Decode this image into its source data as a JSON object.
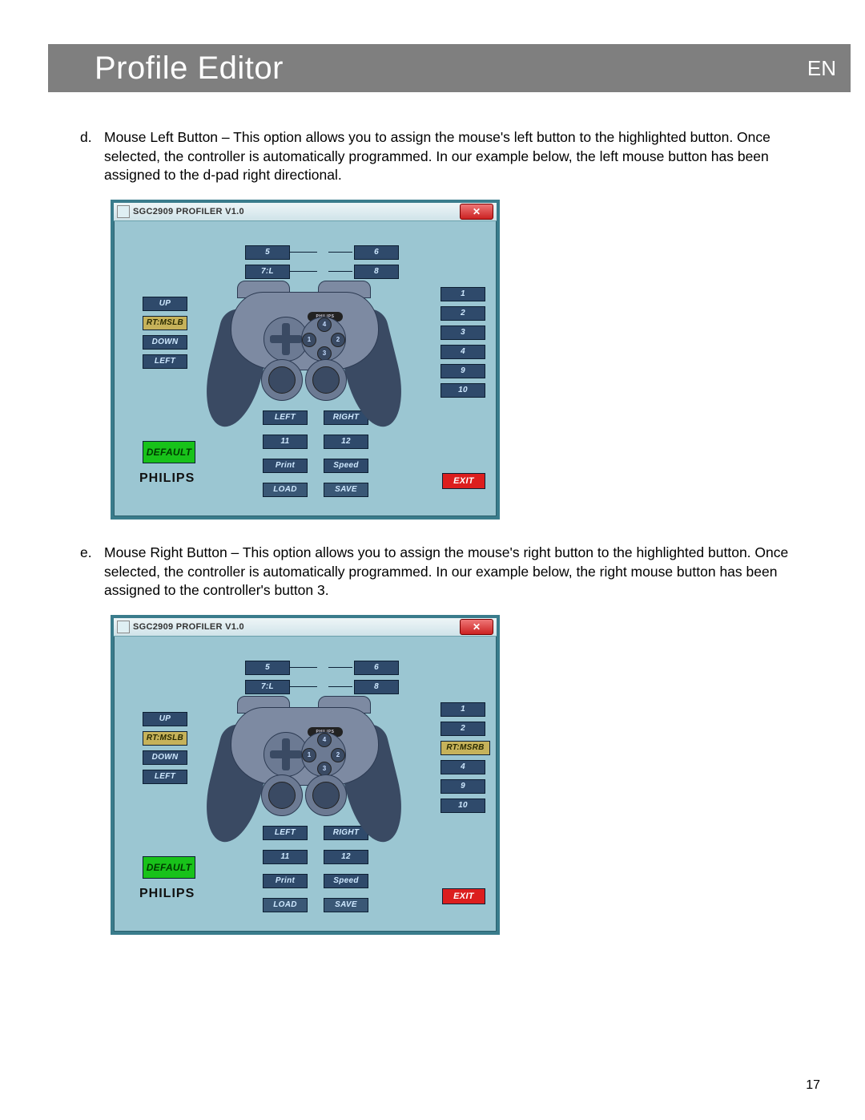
{
  "header": {
    "title": "Profile Editor",
    "lang": "EN"
  },
  "items": [
    {
      "mark": "d.",
      "text": "Mouse Left Button – This option allows you to assign the mouse's left button to the highlighted button. Once selected, the controller is automatically programmed. In our example below, the left mouse button has been assigned to the d-pad right directional."
    },
    {
      "mark": "e.",
      "text": "Mouse Right Button – This option allows you to assign the mouse's right button to the highlighted button. Once selected, the controller is automatically programmed. In our example below, the right mouse button has been assigned to the controller's button 3."
    }
  ],
  "page_number": "17",
  "profiler": {
    "window_title": "SGC2909 PROFILER V1.0",
    "close_glyph": "✕",
    "brand": "PHILIPS",
    "logo_small": "PHILIPS",
    "dpad": {
      "up": "UP",
      "down": "DOWN",
      "left_dir": "LEFT"
    },
    "top_row": {
      "b5": "5",
      "b6": "6",
      "b7": "7:L",
      "b8": "8"
    },
    "right_col": {
      "b1": "1",
      "b2": "2",
      "b3_default": "3",
      "b4": "4",
      "b9": "9",
      "b10": "10"
    },
    "sticks": {
      "left": "LEFT",
      "right": "RIGHT",
      "b11": "11",
      "b12": "12"
    },
    "actions": {
      "print": "Print",
      "speed": "Speed",
      "load": "LOAD",
      "save": "SAVE",
      "default": "DEFAULT",
      "exit": "EXIT"
    },
    "face_labels": {
      "n": "4",
      "e": "2",
      "s": "3",
      "w": "1"
    },
    "fig1": {
      "dpad_right": "RT:MSLB",
      "b3": "3"
    },
    "fig2": {
      "dpad_right": "RT:MSLB",
      "b3": "RT:MSRB"
    }
  }
}
